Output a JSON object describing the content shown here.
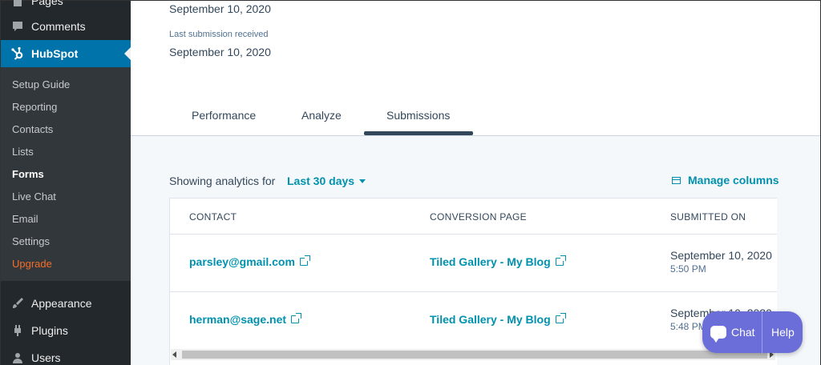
{
  "sidebar": {
    "top_items": [
      {
        "label": "Pages",
        "icon": "pages-icon"
      },
      {
        "label": "Comments",
        "icon": "comments-icon"
      }
    ],
    "active": {
      "label": "HubSpot",
      "icon": "hubspot-sprocket-icon"
    },
    "submenu": [
      {
        "label": "Setup Guide"
      },
      {
        "label": "Reporting"
      },
      {
        "label": "Contacts"
      },
      {
        "label": "Lists"
      },
      {
        "label": "Forms"
      },
      {
        "label": "Live Chat"
      },
      {
        "label": "Email"
      },
      {
        "label": "Settings"
      },
      {
        "label": "Upgrade"
      }
    ],
    "bottom_items": [
      {
        "label": "Appearance",
        "icon": "paintbrush-icon"
      },
      {
        "label": "Plugins",
        "icon": "plugin-icon"
      },
      {
        "label": "Users",
        "icon": "user-icon"
      }
    ],
    "colors": {
      "bg": "#23282d",
      "active": "#0073aa",
      "submenu_bg": "#32373c",
      "upgrade": "#f56e28"
    }
  },
  "form_info": {
    "first_date": "September 10, 2020",
    "last_submission_label": "Last submission received",
    "last_submission_date": "September 10, 2020"
  },
  "tabs": [
    {
      "label": "Performance"
    },
    {
      "label": "Analyze"
    },
    {
      "label": "Submissions"
    }
  ],
  "active_tab": "Submissions",
  "analytics": {
    "showing_label": "Showing analytics for",
    "range_value": "Last 30 days",
    "manage_columns_label": "Manage columns"
  },
  "table": {
    "headers": [
      "CONTACT",
      "CONVERSION PAGE",
      "SUBMITTED ON"
    ],
    "rows": [
      {
        "contact": "parsley@gmail.com",
        "page": "Tiled Gallery - My Blog",
        "date": "September 10, 2020",
        "time": "5:50 PM"
      },
      {
        "contact": "herman@sage.net",
        "page": "Tiled Gallery - My Blog",
        "date": "September 10, 2020",
        "time": "5:48 PM"
      }
    ]
  },
  "chat_widget": {
    "chat_label": "Chat",
    "help_label": "Help",
    "color": "#6b6ed9"
  },
  "accent_color": "#0091ae"
}
